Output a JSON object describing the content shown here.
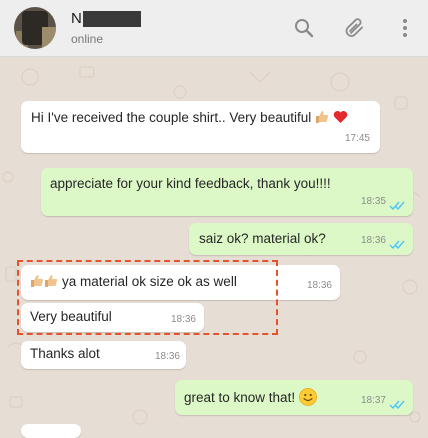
{
  "header": {
    "contact_name": "N",
    "status": "online",
    "icons": [
      "search-icon",
      "paperclip-icon",
      "kebab-menu-icon"
    ]
  },
  "messages": [
    {
      "direction": "incoming",
      "text": "Hi I've received the couple shirt..  Very beautiful",
      "emoji": [
        "thumbs-up",
        "red-heart"
      ],
      "time": "17:45"
    },
    {
      "direction": "outgoing",
      "text": "appreciate for your kind feedback, thank you!!!!",
      "time": "18:35",
      "status": "read"
    },
    {
      "direction": "outgoing",
      "text": "saiz ok? material ok?",
      "time": "18:36",
      "status": "read"
    },
    {
      "direction": "incoming",
      "emoji": [
        "thumbs-up",
        "thumbs-up"
      ],
      "text": "ya material ok size ok as well",
      "time": "18:36"
    },
    {
      "direction": "incoming",
      "text": "Very beautiful",
      "time": "18:36"
    },
    {
      "direction": "incoming",
      "text": "Thanks alot",
      "time": "18:36"
    },
    {
      "direction": "outgoing",
      "text": "great to know that!",
      "emoji": [
        "smiling-face"
      ],
      "time": "18:37",
      "status": "read"
    }
  ],
  "colors": {
    "incoming_bubble": "#ffffff",
    "outgoing_bubble": "#dcf8c6",
    "read_ticks": "#4fc3f7",
    "highlight": "#e5532d",
    "chat_background": "#e6ddd4"
  }
}
